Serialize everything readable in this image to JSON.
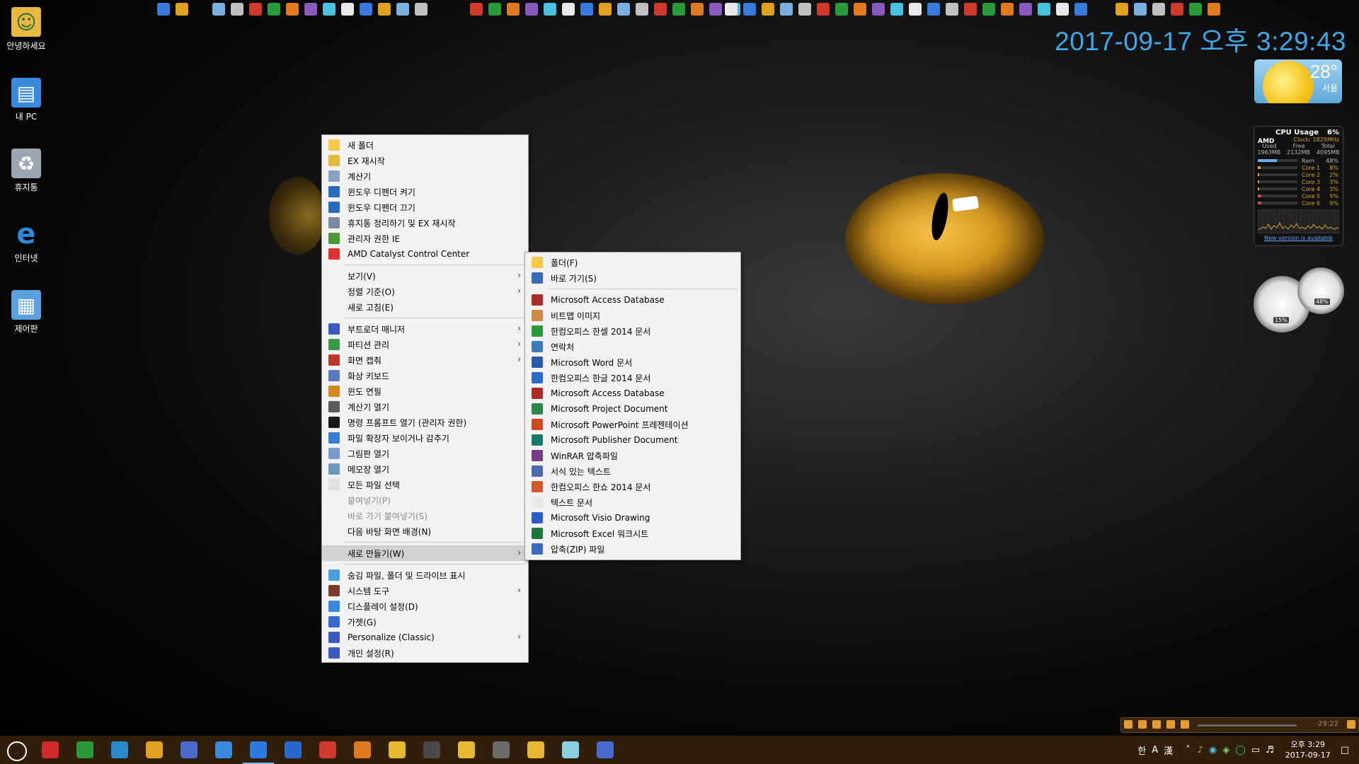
{
  "clock": "2017-09-17 오후 3:29:43",
  "weather": {
    "temp": "28°",
    "city": "서울"
  },
  "cpu": {
    "title": "CPU Usage",
    "percent": "6%",
    "brand": "AMD",
    "clock": "Clock: 1825MHz",
    "mem_headers": [
      "Used",
      "Free",
      "Total"
    ],
    "mem_values": [
      "1963MB",
      "2132MB",
      "4095MB"
    ],
    "rows": [
      {
        "label": "Ram",
        "value": "48%",
        "level": 0.48
      },
      {
        "label": "Core 1",
        "value": "8%",
        "level": 0.08
      },
      {
        "label": "Core 2",
        "value": "2%",
        "level": 0.02
      },
      {
        "label": "Core 3",
        "value": "3%",
        "level": 0.03
      },
      {
        "label": "Core 4",
        "value": "3%",
        "level": 0.03
      },
      {
        "label": "Core 5",
        "value": "9%",
        "level": 0.09
      },
      {
        "label": "Core 6",
        "value": "9%",
        "level": 0.09
      }
    ],
    "new_version": "New version is available"
  },
  "gauges": {
    "left": "15%",
    "right": "48%"
  },
  "desktop_icons": [
    {
      "label": "안녕하세요",
      "icon": "user-folder-icon"
    },
    {
      "label": "내 PC",
      "icon": "computer-icon"
    },
    {
      "label": "휴지통",
      "icon": "recycle-bin-icon"
    },
    {
      "label": "인터넷",
      "icon": "internet-explorer-icon"
    },
    {
      "label": "제어판",
      "icon": "control-panel-icon"
    }
  ],
  "context_menu": [
    {
      "type": "item",
      "label": "새 폴더",
      "icon": "folder-icon",
      "color": "#f5c84a"
    },
    {
      "type": "item",
      "label": "EX 재시작",
      "icon": "explorer-icon",
      "color": "#e2b83a"
    },
    {
      "type": "item",
      "label": "계산기",
      "icon": "calculator-icon",
      "color": "#8aa0c0"
    },
    {
      "type": "item",
      "label": "윈도우 디펜더 켜기",
      "icon": "defender-icon",
      "color": "#2a6abf"
    },
    {
      "type": "item",
      "label": "윈도우 디펜더 끄기",
      "icon": "defender-icon",
      "color": "#2a6abf"
    },
    {
      "type": "item",
      "label": "휴지통 정리하기 및 EX 재시작",
      "icon": "recycle-icon",
      "color": "#7a8aa0"
    },
    {
      "type": "item",
      "label": "관리자 권한 IE",
      "icon": "ie-icon",
      "color": "#4a9a3a"
    },
    {
      "type": "item",
      "label": "AMD Catalyst Control Center",
      "icon": "amd-icon",
      "color": "#e03030"
    },
    {
      "type": "sep"
    },
    {
      "type": "item",
      "label": "보기(V)",
      "submenu": true
    },
    {
      "type": "item",
      "label": "정렬 기준(O)",
      "submenu": true
    },
    {
      "type": "item",
      "label": "새로 고침(E)"
    },
    {
      "type": "sep"
    },
    {
      "type": "item",
      "label": "부트로더 매니저",
      "icon": "bootloader-icon",
      "color": "#3a5abf",
      "submenu": true
    },
    {
      "type": "item",
      "label": "파티션 관리",
      "icon": "partition-icon",
      "color": "#3a9a4a",
      "submenu": true
    },
    {
      "type": "item",
      "label": "화면 캡춰",
      "icon": "capture-icon",
      "color": "#c03a2a",
      "submenu": true
    },
    {
      "type": "item",
      "label": "화상 키보드",
      "icon": "keyboard-icon",
      "color": "#5a7abf"
    },
    {
      "type": "item",
      "label": "윈도 연필",
      "icon": "pencil-icon",
      "color": "#d08a20"
    },
    {
      "type": "item",
      "label": "계산기 열기",
      "icon": "calculator-icon",
      "color": "#5a5a5a"
    },
    {
      "type": "item",
      "label": "명령 프롬프트 열기 (관리자 권한)",
      "icon": "cmd-icon",
      "color": "#1a1a1a"
    },
    {
      "type": "item",
      "label": "파일 확장자 보이거나 감추기",
      "icon": "file-ext-icon",
      "color": "#3a7acf"
    },
    {
      "type": "item",
      "label": "그림판 열기",
      "icon": "paint-icon",
      "color": "#7a9acf"
    },
    {
      "type": "item",
      "label": "메모장 열기",
      "icon": "notepad-icon",
      "color": "#6a9abf"
    },
    {
      "type": "item",
      "label": "모든 파일 선택",
      "icon": "select-all-icon",
      "color": "#e0e0e0"
    },
    {
      "type": "item",
      "label": "붙여넣기(P)",
      "disabled": true
    },
    {
      "type": "item",
      "label": "바로 가기 붙여넣기(S)",
      "disabled": true
    },
    {
      "type": "item",
      "label": "다음 바탕 화면 배경(N)"
    },
    {
      "type": "sep"
    },
    {
      "type": "item",
      "label": "새로 만들기(W)",
      "submenu": true,
      "highlight": true
    },
    {
      "type": "sep"
    },
    {
      "type": "item",
      "label": "숨김 파일, 폴더 및 드라이브 표시",
      "icon": "hidden-files-icon",
      "color": "#4aa0df"
    },
    {
      "type": "item",
      "label": "시스템 도구",
      "icon": "tools-icon",
      "color": "#7a3a2a",
      "submenu": true
    },
    {
      "type": "item",
      "label": "디스플레이 설정(D)",
      "icon": "display-icon",
      "color": "#3a8adf"
    },
    {
      "type": "item",
      "label": "가젯(G)",
      "icon": "gadget-icon",
      "color": "#3a6acf"
    },
    {
      "type": "item",
      "label": "Personalize (Classic)",
      "icon": "personalize-icon",
      "color": "#3a5abf",
      "submenu": true
    },
    {
      "type": "item",
      "label": "개인 설정(R)",
      "icon": "personalize-icon",
      "color": "#3a5abf"
    }
  ],
  "submenu": [
    {
      "type": "item",
      "label": "폴더(F)",
      "icon": "folder-icon",
      "color": "#f5c84a"
    },
    {
      "type": "item",
      "label": "바로 가기(S)",
      "icon": "shortcut-icon",
      "color": "#3a6abf"
    },
    {
      "type": "sep"
    },
    {
      "type": "item",
      "label": "Microsoft Access Database",
      "icon": "access-icon",
      "color": "#b02a2a"
    },
    {
      "type": "item",
      "label": "비트맵 이미지",
      "icon": "bitmap-icon",
      "color": "#d08a40"
    },
    {
      "type": "item",
      "label": "한컴오피스 한셀 2014 문서",
      "icon": "hancell-icon",
      "color": "#2a9a3a"
    },
    {
      "type": "item",
      "label": "연락처",
      "icon": "contact-icon",
      "color": "#3a7abf"
    },
    {
      "type": "item",
      "label": "Microsoft Word 문서",
      "icon": "word-icon",
      "color": "#2a5aaf"
    },
    {
      "type": "item",
      "label": "한컴오피스 한글 2014 문서",
      "icon": "hwp-icon",
      "color": "#2a6acf"
    },
    {
      "type": "item",
      "label": "Microsoft Access Database",
      "icon": "access-icon",
      "color": "#b02a2a"
    },
    {
      "type": "item",
      "label": "Microsoft Project Document",
      "icon": "project-icon",
      "color": "#2a8a4a"
    },
    {
      "type": "item",
      "label": "Microsoft PowerPoint 프레젠테이션",
      "icon": "powerpoint-icon",
      "color": "#d04a20"
    },
    {
      "type": "item",
      "label": "Microsoft Publisher Document",
      "icon": "publisher-icon",
      "color": "#1a7a6a"
    },
    {
      "type": "item",
      "label": "WinRAR 압축파일",
      "icon": "winrar-icon",
      "color": "#7a3a8a"
    },
    {
      "type": "item",
      "label": "서식 있는 텍스트",
      "icon": "rtf-icon",
      "color": "#4a6aaf"
    },
    {
      "type": "item",
      "label": "한컴오피스 한쇼 2014 문서",
      "icon": "hanshow-icon",
      "color": "#d05a2a"
    },
    {
      "type": "item",
      "label": "텍스트 문서",
      "icon": "text-doc-icon",
      "color": "#e8e8e8"
    },
    {
      "type": "item",
      "label": "Microsoft Visio Drawing",
      "icon": "visio-icon",
      "color": "#2a5acf"
    },
    {
      "type": "item",
      "label": "Microsoft Excel 워크시트",
      "icon": "excel-icon",
      "color": "#1a7a3a"
    },
    {
      "type": "item",
      "label": "압축(ZIP) 파일",
      "icon": "zip-icon",
      "color": "#3a6abf"
    }
  ],
  "taskbar": {
    "items": [
      {
        "icon": "cortana-icon",
        "color": "transparent"
      },
      {
        "icon": "power-icon",
        "color": "#d02a2a"
      },
      {
        "icon": "refresh-icon",
        "color": "#2a9a3a"
      },
      {
        "icon": "exit-icon",
        "color": "#2a8acf"
      },
      {
        "icon": "shutdown-icon",
        "color": "#e0a020"
      },
      {
        "icon": "network-icon",
        "color": "#4a6acf"
      },
      {
        "icon": "settings-icon",
        "color": "#3a8adf"
      },
      {
        "icon": "ie-icon",
        "color": "#2a7adf"
      },
      {
        "icon": "edge-icon",
        "color": "#2a6acf"
      },
      {
        "icon": "chrome-icon",
        "color": "#d03a2a"
      },
      {
        "icon": "firefox-icon",
        "color": "#e07a20"
      },
      {
        "icon": "file-explorer-icon",
        "color": "#e8b830"
      },
      {
        "icon": "store-icon",
        "color": "#4a4a4a"
      },
      {
        "icon": "folder-icon",
        "color": "#e8b830"
      },
      {
        "icon": "mail-icon",
        "color": "#6a6a6a"
      },
      {
        "icon": "folder-icon",
        "color": "#e8b830"
      },
      {
        "icon": "notes-icon",
        "color": "#8acfdf"
      },
      {
        "icon": "network-icon",
        "color": "#4a6acf"
      }
    ],
    "ime": [
      "한",
      "A",
      "漢"
    ],
    "time": "오후 3:29",
    "date": "2017-09-17"
  },
  "media": {
    "time": "-29:22"
  }
}
